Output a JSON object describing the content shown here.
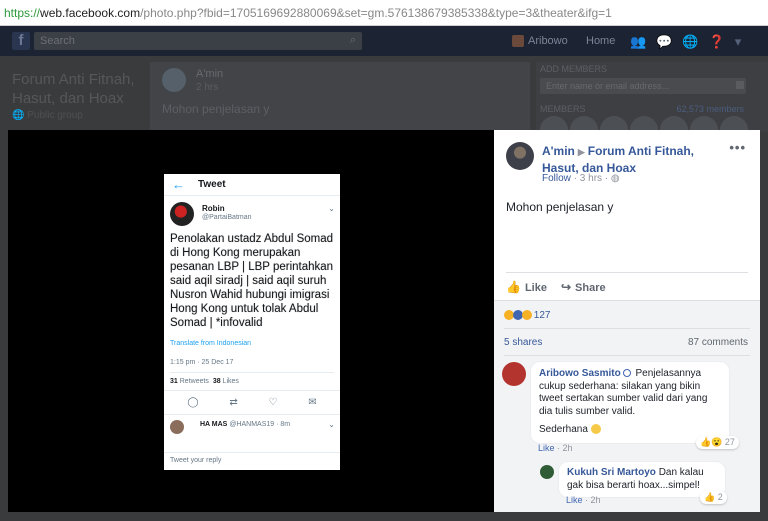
{
  "url": {
    "scheme": "https://",
    "host": "web.facebook.com",
    "path": "/photo.php?fbid=1705169692880069&set=gm.576138679385338&type=3&theater&ifg=1"
  },
  "fb_bg": {
    "search_placeholder": "Search",
    "user_name": "Aribowo",
    "home": "Home",
    "group_title": "Forum Anti Fitnah, Hasut, dan Hoax",
    "group_privacy": "Public group",
    "post_author": "A'min",
    "post_time": "2 hrs",
    "post_text": "Mohon penjelasan y",
    "add_members": "ADD MEMBERS",
    "add_members_placeholder": "Enter name or email address...",
    "members_label": "MEMBERS",
    "members_count": "62,573 members"
  },
  "photo": {
    "header_title": "Tweet",
    "user_name": "Robin",
    "user_handle": "@PartaiBatman",
    "tweet_text": "Penolakan ustadz Abdul Somad di Hong Kong merupakan pesanan LBP | LBP perintahkan said aqil siradj | said aqil suruh Nusron Wahid hubungi imigrasi Hong Kong untuk tolak Abdul Somad | *infovalid",
    "translate": "Translate from Indonesian",
    "time": "1:15 pm · 25 Dec 17",
    "retweets_count": "31",
    "retweets_label": "Retweets",
    "likes_count": "38",
    "likes_label": "Likes",
    "reply_user": "HA MAS",
    "reply_handle": "@HANMAS19 · 8m",
    "reply_placeholder": "Tweet your reply"
  },
  "post": {
    "author": "A'min",
    "group": "Forum Anti Fitnah, Hasut, dan Hoax",
    "follow": "Follow",
    "time": "· 3 hrs ·",
    "text": "Mohon penjelasan y",
    "like_label": "Like",
    "share_label": "Share",
    "reaction_count": "127",
    "shares": "5 shares",
    "comments_count": "87 comments"
  },
  "comments": [
    {
      "author": "Aribowo Sasmito",
      "text": "Penjelasannya cukup sederhana: silakan yang bikin tweet sertakan sumber valid dari yang dia tulis sumber valid.",
      "text2": "Sederhana",
      "like": "Like",
      "time": "· 2h",
      "reactions": "27"
    },
    {
      "author": "Kukuh Sri Martoyo",
      "text": "Dan kalau gak bisa berarti hoax...simpel!",
      "like": "Like",
      "time": "· 2h",
      "reactions": "2"
    }
  ],
  "colors": {
    "fb_link": "#365899",
    "twitter_blue": "#1da1f2",
    "https_green": "#2d9a3c"
  }
}
